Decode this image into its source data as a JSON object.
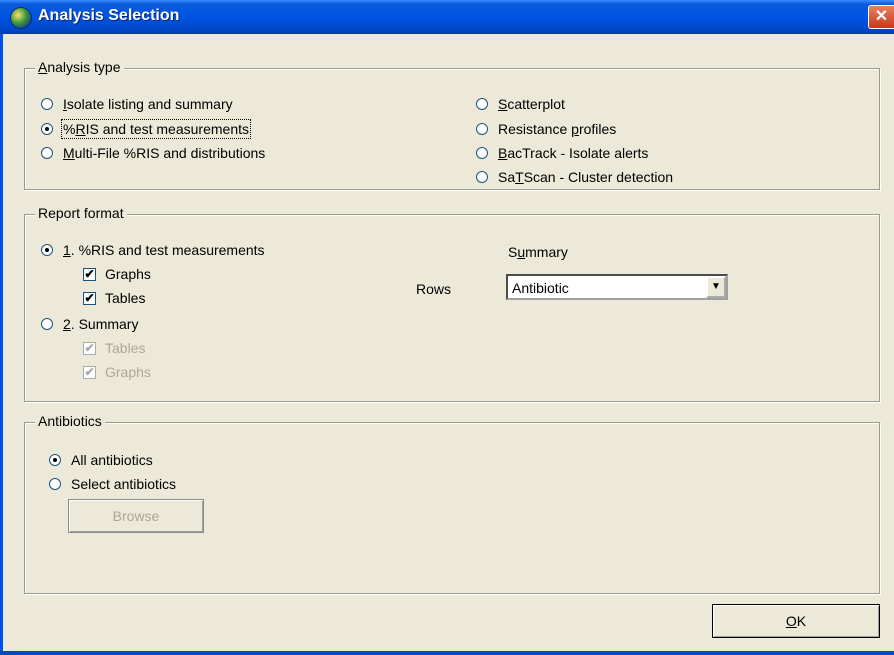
{
  "window": {
    "title": "Analysis Selection",
    "close_glyph": "✕"
  },
  "analysis_type": {
    "legend_prefix": "A",
    "legend_rest": "nalysis type",
    "left": [
      {
        "label": "Isolate listing and summary",
        "u_pre": "",
        "u": "I",
        "u_post": "solate listing and summary",
        "selected": false
      },
      {
        "label": "%RIS and test measurements",
        "u_pre": "%",
        "u": "R",
        "u_post": "IS and test measurements",
        "selected": true
      },
      {
        "label": "Multi-File %RIS and distributions",
        "u_pre": "",
        "u": "M",
        "u_post": "ulti-File %RIS and distributions",
        "selected": false
      }
    ],
    "right": [
      {
        "u_pre": "",
        "u": "S",
        "u_post": "catterplot",
        "selected": false
      },
      {
        "u_pre": "Resistance ",
        "u": "p",
        "u_post": "rofiles",
        "selected": false
      },
      {
        "u_pre": "",
        "u": "B",
        "u_post": "acTrack - Isolate alerts",
        "selected": false
      },
      {
        "u_pre": "Sa",
        "u": "T",
        "u_post": "Scan - Cluster detection",
        "selected": false
      }
    ]
  },
  "report_format": {
    "legend": "Report format",
    "option1": {
      "u": "1",
      "rest": ". %RIS and test measurements",
      "selected": true
    },
    "option1_checks": [
      {
        "label": "Graphs",
        "checked": true
      },
      {
        "label": "Tables",
        "checked": true
      }
    ],
    "option2": {
      "u": "2",
      "rest": ". Summary",
      "selected": false
    },
    "option2_checks": [
      {
        "label": "Tables",
        "checked": true,
        "disabled": true
      },
      {
        "label": "Graphs",
        "checked": true,
        "disabled": true
      }
    ],
    "summary_heading_pre": "S",
    "summary_heading_u": "u",
    "summary_heading_post": "mmary",
    "rows_label": "Rows",
    "rows_value": "Antibiotic",
    "dropdown_glyph": "▼"
  },
  "antibiotics": {
    "legend": "Antibiotics",
    "all_label": "All antibiotics",
    "all_selected": true,
    "select_label": "Select antibiotics",
    "select_selected": false,
    "browse_label": "Browse"
  },
  "ok_button": {
    "u": "O",
    "rest": "K"
  },
  "check_glyph": "✔"
}
